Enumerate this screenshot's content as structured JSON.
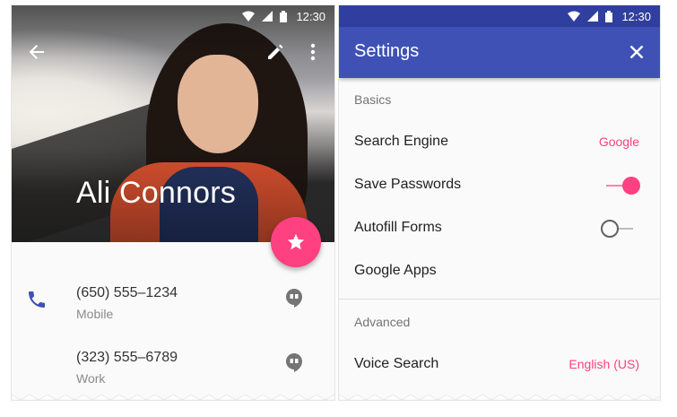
{
  "colors": {
    "primary": "#3f51b5",
    "primary_dark": "#303f9f",
    "accent": "#ff4081",
    "icon_blue": "#3f51b5",
    "icon_gray": "#757575"
  },
  "status_bar": {
    "time": "12:30"
  },
  "contact": {
    "name": "Ali Connors",
    "toolbar": {
      "back_icon": "arrow-back-icon",
      "edit_icon": "pencil-icon",
      "more_icon": "more-vert-icon"
    },
    "fab_icon": "star-icon",
    "phones": [
      {
        "number": "(650) 555–1234",
        "type": "Mobile",
        "icon": "phone-icon",
        "action_icon": "hangouts-icon"
      },
      {
        "number": "(323) 555–6789",
        "type": "Work",
        "icon": "",
        "action_icon": "hangouts-icon"
      }
    ]
  },
  "settings": {
    "title": "Settings",
    "close_icon": "close-icon",
    "sections": [
      {
        "header": "Basics",
        "items": [
          {
            "label": "Search Engine",
            "value": "Google"
          },
          {
            "label": "Save Passwords",
            "toggle": true
          },
          {
            "label": "Autofill Forms",
            "toggle": false
          },
          {
            "label": "Google Apps"
          }
        ]
      },
      {
        "header": "Advanced",
        "items": [
          {
            "label": "Voice Search",
            "value": "English (US)"
          }
        ]
      }
    ]
  }
}
